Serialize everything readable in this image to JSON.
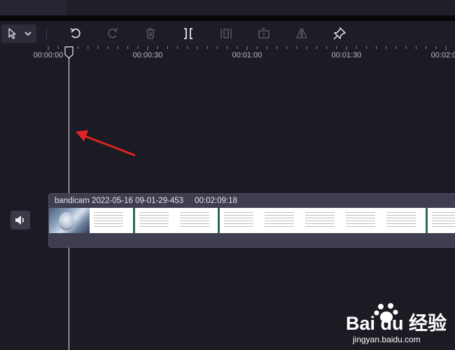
{
  "toolbar": {
    "tools": [
      {
        "name": "select-tool",
        "icon": "cursor-arrow-icon"
      },
      {
        "name": "undo",
        "icon": "undo-icon"
      },
      {
        "name": "redo",
        "icon": "redo-icon"
      },
      {
        "name": "delete",
        "icon": "trash-icon"
      },
      {
        "name": "split",
        "icon": "split-icon"
      },
      {
        "name": "trim",
        "icon": "trim-icon"
      },
      {
        "name": "crop",
        "icon": "crop-icon"
      },
      {
        "name": "mirror",
        "icon": "mirror-icon"
      },
      {
        "name": "pin",
        "icon": "pin-icon"
      }
    ]
  },
  "timeline": {
    "ruler_labels": [
      "00:00:00",
      "00:00:30",
      "00:01:00",
      "00:01:30",
      "00:02:0"
    ],
    "playhead_time": "00:00:00"
  },
  "track": {
    "audio_icon": "speaker-icon",
    "clip": {
      "name": "bandicam 2022-05-16 09-01-29-453",
      "duration": "00:02:09:18"
    }
  },
  "annotation": {
    "arrow_color": "#e02424"
  },
  "watermark": {
    "logo": "Bai du 经验",
    "url": "jingyan.baidu.com"
  },
  "colors": {
    "background": "#1b1b24",
    "toolbar": "#1d1d27",
    "clip": "#3e3e50",
    "playhead": "#e8e8ee"
  }
}
